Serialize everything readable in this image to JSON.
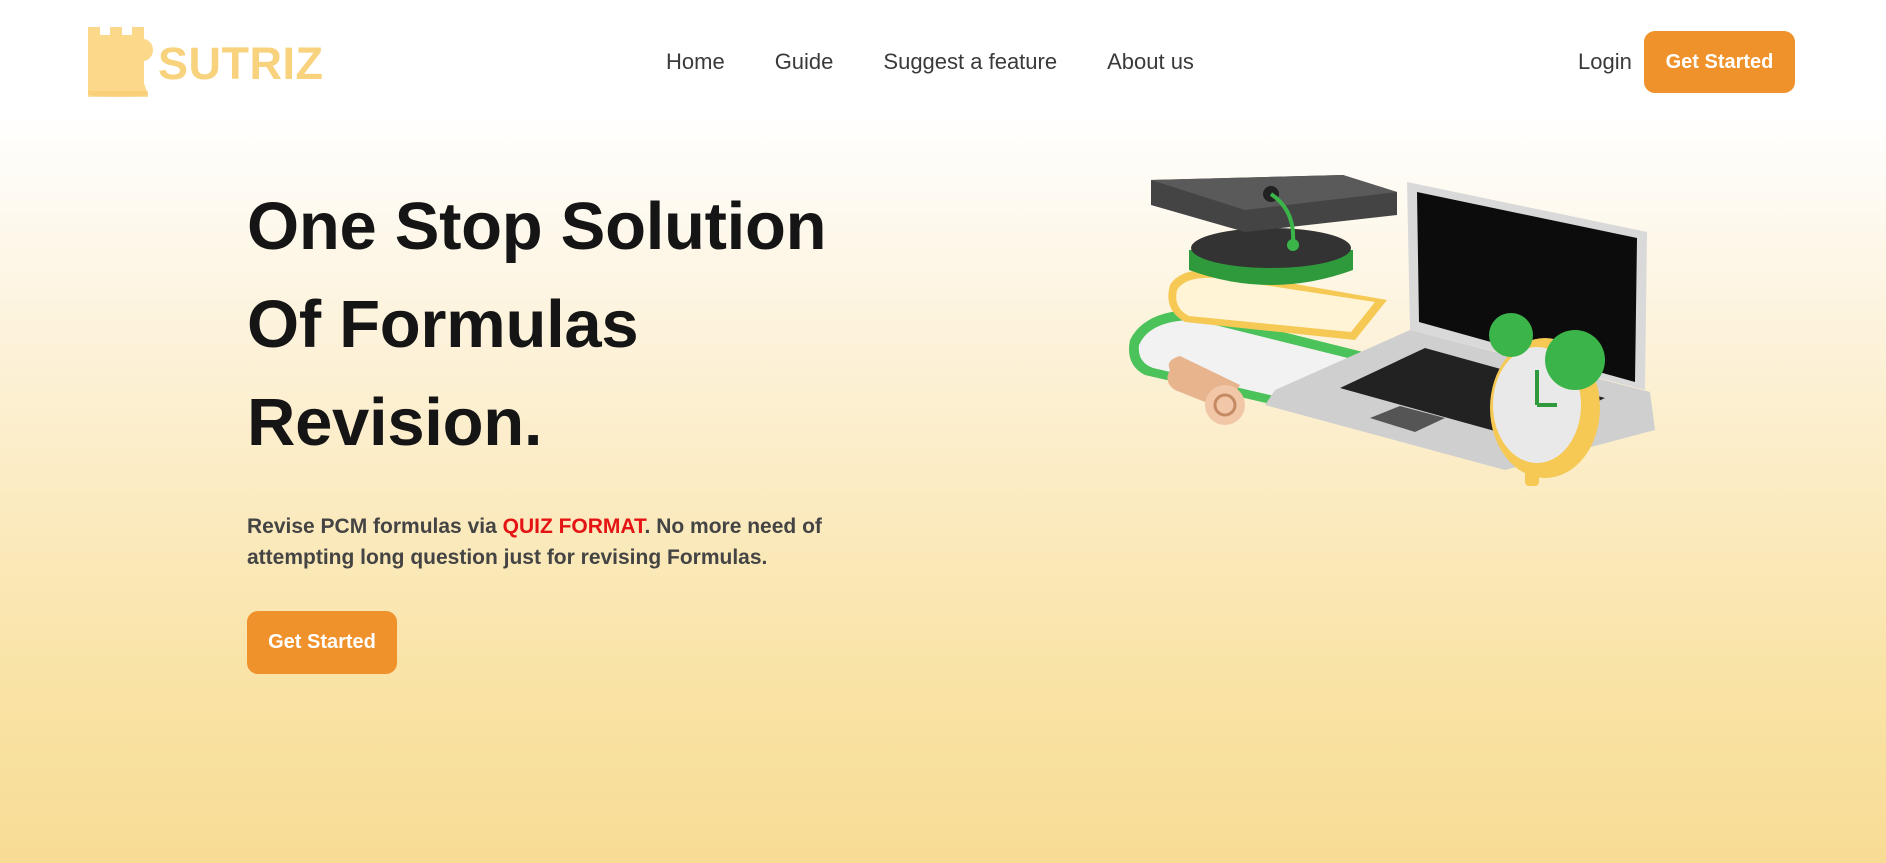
{
  "brand": {
    "name": "SUTRIZ",
    "color": "#f8d27d"
  },
  "nav": {
    "items": [
      {
        "label": "Home"
      },
      {
        "label": "Guide"
      },
      {
        "label": "Suggest a feature"
      },
      {
        "label": "About us"
      }
    ],
    "login_label": "Login",
    "cta_label": "Get Started"
  },
  "hero": {
    "title_lines": [
      "One Stop Solution",
      "Of Formulas",
      "Revision."
    ],
    "description": {
      "before": "Revise PCM formulas via ",
      "highlight": "QUIZ FORMAT",
      "after": ". No more need of attempting long question just for revising Formulas."
    },
    "cta_label": "Get Started",
    "illustration_icon": "education-illustration"
  },
  "colors": {
    "accent": "#f0922b",
    "highlight": "#e51414",
    "background_bottom": "#f8dc95"
  }
}
